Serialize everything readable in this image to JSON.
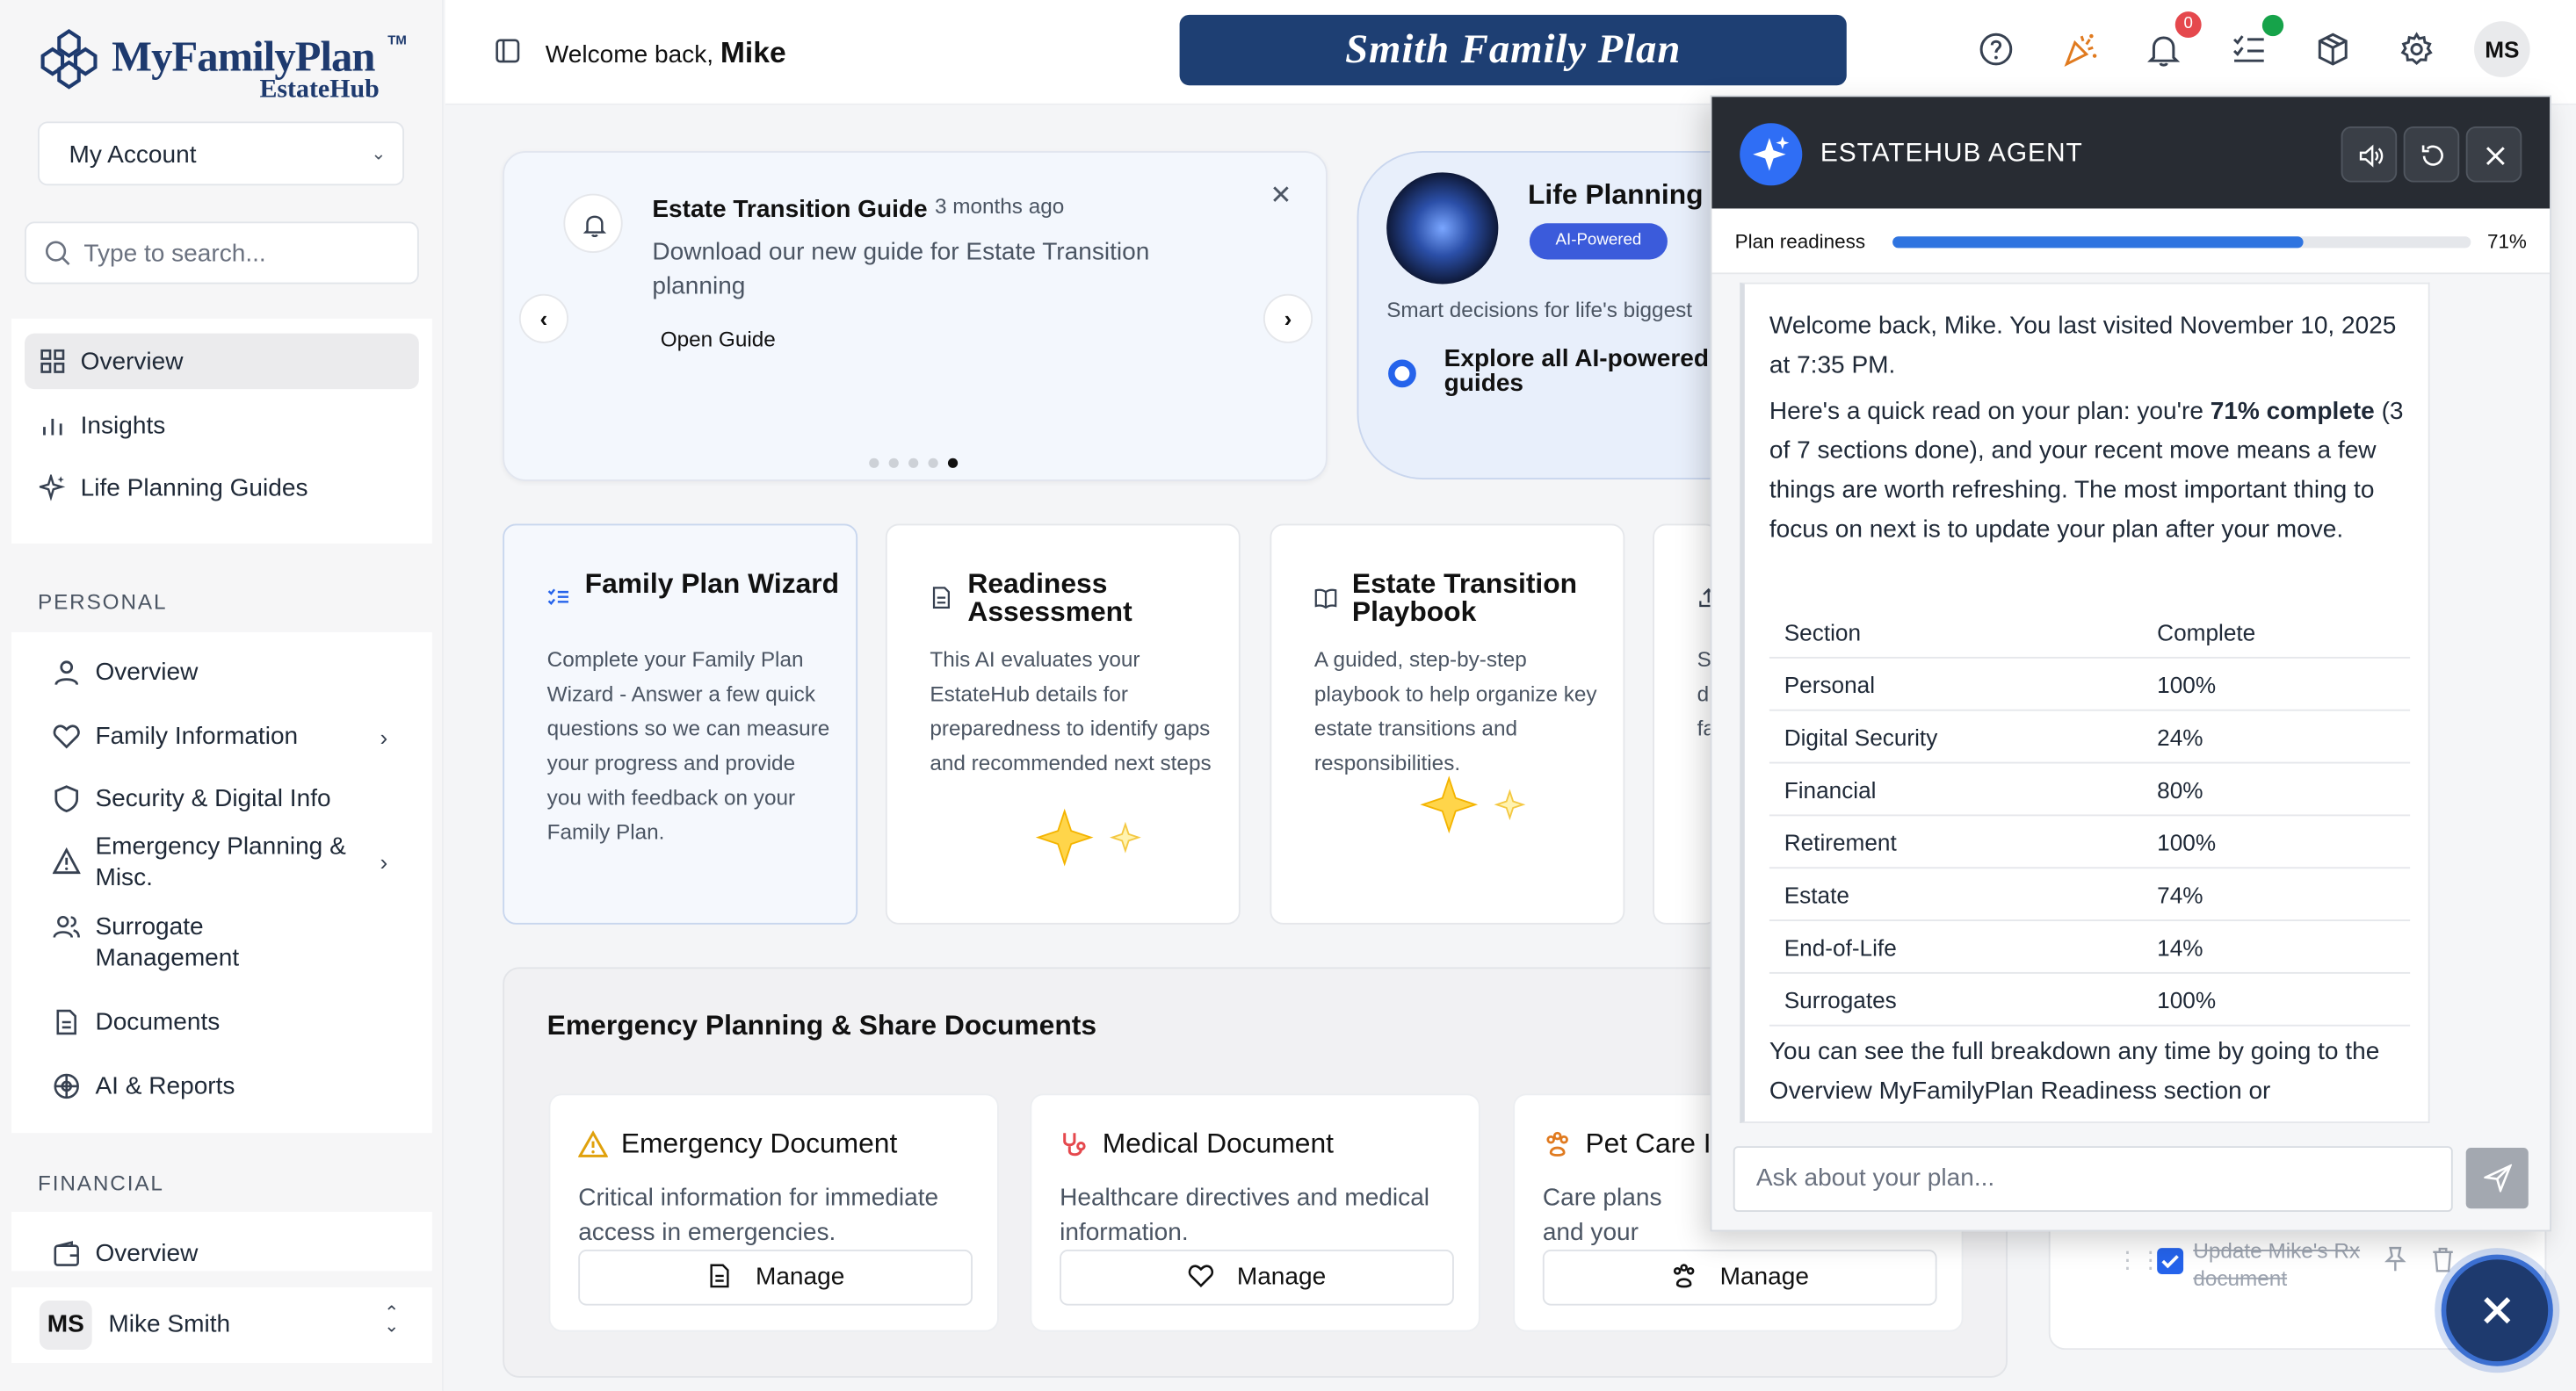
{
  "brand": {
    "name": "MyFamilyPlan",
    "tm": "TM",
    "sub": "EstateHub"
  },
  "sidebar": {
    "account_select": "My Account",
    "search_placeholder": "Type to search...",
    "top_nav": [
      {
        "label": "Overview",
        "icon": "grid-icon"
      },
      {
        "label": "Insights",
        "icon": "bar-chart-icon"
      },
      {
        "label": "Life Planning Guides",
        "icon": "sparkle-icon"
      }
    ],
    "personal_label": "PERSONAL",
    "personal": [
      {
        "label": "Overview",
        "icon": "user-icon"
      },
      {
        "label": "Family Information",
        "icon": "heart-icon"
      },
      {
        "label": "Security & Digital Info",
        "icon": "shield-icon"
      },
      {
        "label": "Emergency Planning & Misc.",
        "icon": "warning-icon"
      },
      {
        "label": "Surrogate Management",
        "icon": "users-icon"
      },
      {
        "label": "Documents",
        "icon": "document-icon"
      },
      {
        "label": "AI & Reports",
        "icon": "ai-icon"
      }
    ],
    "financial_label": "FINANCIAL",
    "financial": [
      {
        "label": "Overview",
        "icon": "wallet-icon"
      }
    ],
    "user": {
      "initials": "MS",
      "name": "Mike Smith"
    }
  },
  "header": {
    "welcome": "Welcome back,",
    "user_first": "Mike",
    "plan_name": "Smith Family Plan",
    "notif_count": "0",
    "avatar": "MS"
  },
  "guide": {
    "title": "Estate Transition Guide",
    "time": "3 months ago",
    "desc": "Download our new guide for Estate Transition planning",
    "link": "Open Guide",
    "prev": "‹",
    "next": "›"
  },
  "life_planning": {
    "title": "Life Planning G",
    "pill": "AI-Powered",
    "sub": "Smart decisions for life's biggest",
    "explore": "Explore all AI-powered guides"
  },
  "features": [
    {
      "title": "Family Plan Wizard",
      "desc": "Complete your Family Plan Wizard - Answer a few quick questions so we can measure your progress and provide you with feedback on your Family Plan."
    },
    {
      "title": "Readiness Assessment",
      "desc": "This AI evaluates your EstateHub details for preparedness to identify gaps and recommended next steps"
    },
    {
      "title": "Estate Transition Playbook",
      "desc": "A guided, step-by-step playbook to help organize key estate transitions and responsibilities."
    },
    {
      "title": "",
      "desc": "S d fa"
    }
  ],
  "emergency": {
    "title": "Emergency Planning & Share Documents",
    "cards": [
      {
        "title": "Emergency Document",
        "desc": "Critical information for immediate access in emergencies.",
        "btn": "Manage"
      },
      {
        "title": "Medical Document",
        "desc": "Healthcare directives and medical information.",
        "btn": "Manage"
      },
      {
        "title": "Pet Care I",
        "desc": "Care plans and your pets.",
        "btn": "Manage"
      }
    ]
  },
  "todo": {
    "text": "Update Mike's Rx document"
  },
  "agent": {
    "title": "ESTATEHUB AGENT",
    "readiness_label": "Plan readiness",
    "readiness_pct": "71%",
    "readiness_value": 71,
    "p1": "Welcome back, Mike. You last visited November 10, 2025 at 7:35 PM.",
    "p2_a": "Here's a quick read on your plan: you're ",
    "p2_b": "71% complete",
    "p2_c": " (3 of 7 sections done), and your recent move means a few things are worth refreshing. The most important thing to focus on next is to update your plan after your move.",
    "table_head": [
      "Section",
      "Complete"
    ],
    "table": [
      [
        "Personal",
        "100%"
      ],
      [
        "Digital Security",
        "24%"
      ],
      [
        "Financial",
        "80%"
      ],
      [
        "Retirement",
        "100%"
      ],
      [
        "Estate",
        "74%"
      ],
      [
        "End-of-Life",
        "14%"
      ],
      [
        "Surrogates",
        "100%"
      ]
    ],
    "p3": "You can see the full breakdown any time by going to the Overview MyFamilyPlan Readiness section or",
    "ask_placeholder": "Ask about your plan..."
  },
  "colors": {
    "brand_navy": "#1e3f73",
    "accent_blue": "#2f74e0",
    "agent_header": "#282c33"
  }
}
